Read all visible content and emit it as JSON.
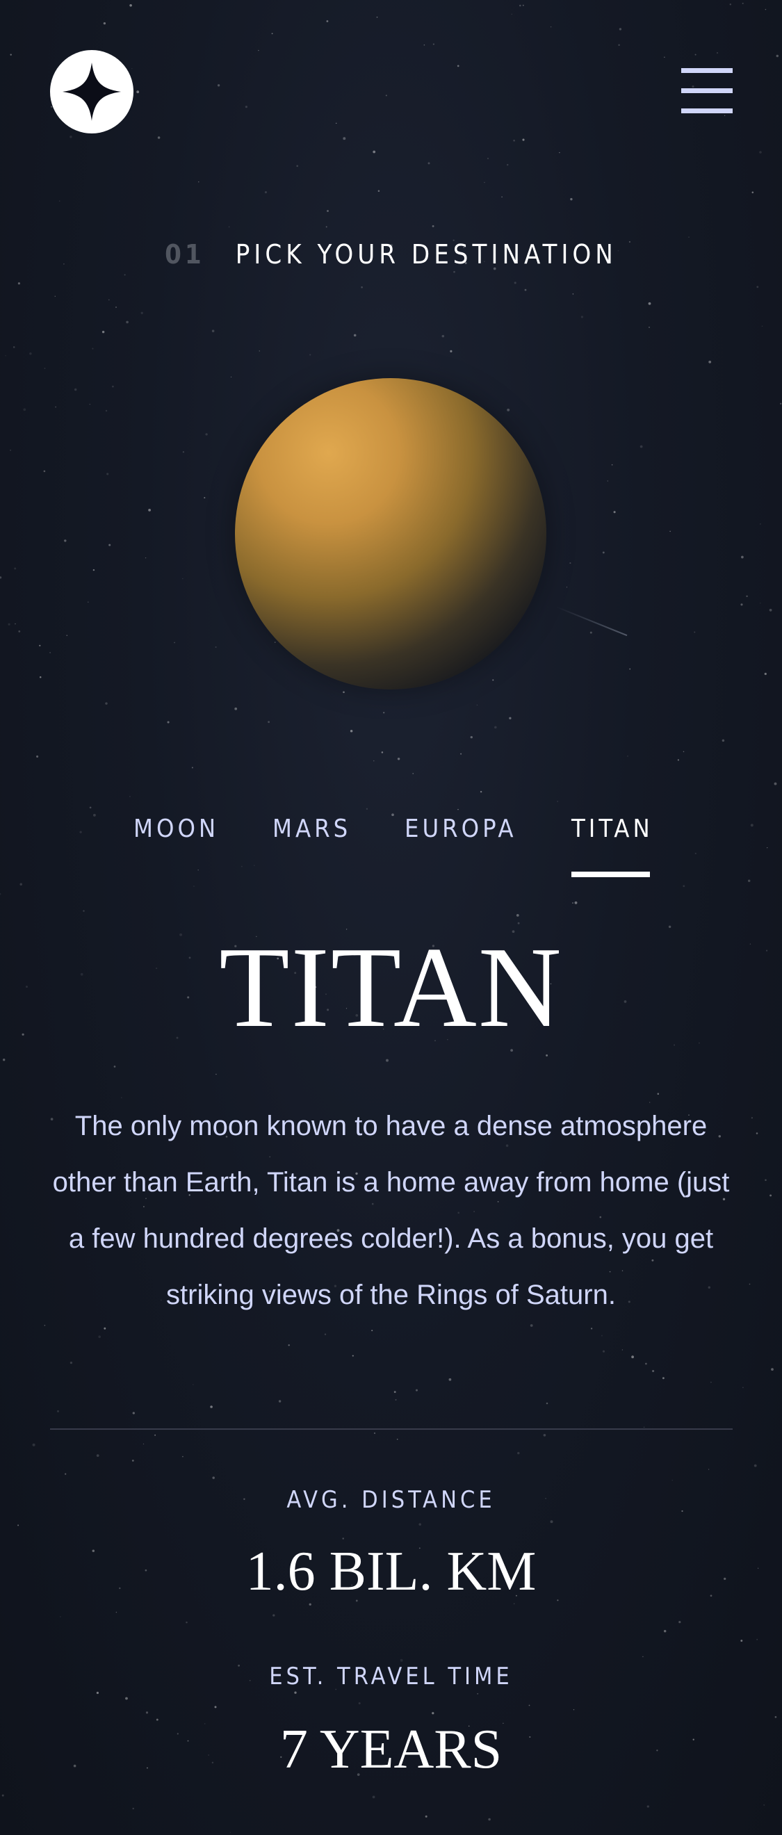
{
  "header": {
    "logo_icon": "star-logo-icon",
    "menu_icon": "hamburger-menu-icon"
  },
  "section": {
    "number": "01",
    "title": "PICK YOUR DESTINATION"
  },
  "planet": {
    "icon": "titan-planet-image"
  },
  "tabs": [
    {
      "label": "MOON",
      "active": false
    },
    {
      "label": "MARS",
      "active": false
    },
    {
      "label": "EUROPA",
      "active": false
    },
    {
      "label": "TITAN",
      "active": true
    }
  ],
  "destination": {
    "name": "TITAN",
    "description": "The only moon known to have a dense atmosphere other than Earth, Titan is a home away from home (just a few hundred degrees colder!). As a bonus, you get striking views of the Rings of Saturn."
  },
  "stats": {
    "distance_label": "AVG. DISTANCE",
    "distance_value": "1.6 BIL. KM",
    "travel_label": "EST. TRAVEL TIME",
    "travel_value": "7 YEARS"
  },
  "colors": {
    "background": "#141925",
    "text": "#ffffff",
    "accent": "#d0d6f9",
    "muted": "#515660",
    "divider": "#383b4b"
  }
}
